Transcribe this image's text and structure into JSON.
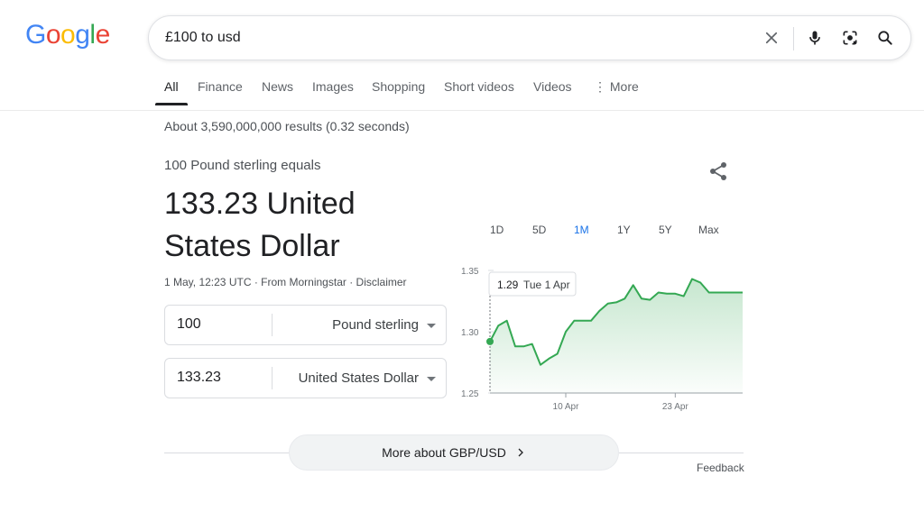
{
  "logo": {
    "letters": [
      "G",
      "o",
      "o",
      "g",
      "l",
      "e"
    ],
    "colors": [
      "#4285f4",
      "#ea4335",
      "#fbbc05",
      "#4285f4",
      "#34a853",
      "#ea4335"
    ]
  },
  "search": {
    "query": "£100 to usd",
    "icons": [
      "clear-icon",
      "mic-icon",
      "lens-icon",
      "search-icon"
    ]
  },
  "tabs": [
    {
      "label": "All",
      "active": true
    },
    {
      "label": "Finance"
    },
    {
      "label": "News"
    },
    {
      "label": "Images"
    },
    {
      "label": "Shopping"
    },
    {
      "label": "Short videos"
    },
    {
      "label": "Videos"
    },
    {
      "label": "More",
      "icon": "more-vert-icon"
    }
  ],
  "stats": "About 3,590,000,000 results (0.32 seconds)",
  "converter": {
    "equals_label": "100 Pound sterling equals",
    "result": "133.23 United States Dollar",
    "timestamp": "1 May, 12:23 UTC",
    "source": "From Morningstar",
    "disclaimer": "Disclaimer",
    "dot": "·",
    "from": {
      "value": "100",
      "unit": "Pound sterling"
    },
    "to": {
      "value": "133.23",
      "unit": "United States Dollar"
    }
  },
  "ranges": [
    {
      "label": "1D"
    },
    {
      "label": "5D"
    },
    {
      "label": "1M",
      "active": true
    },
    {
      "label": "1Y"
    },
    {
      "label": "5Y"
    },
    {
      "label": "Max"
    }
  ],
  "tooltip": {
    "value": "1.29",
    "date": "Tue 1 Apr"
  },
  "accent_color": "#34a853",
  "active_tab_color": "#1a73e8",
  "more_button": "More about GBP/USD",
  "feedback": "Feedback",
  "chart_data": {
    "type": "area",
    "title": "",
    "xlabel": "",
    "ylabel": "",
    "ylim": [
      1.25,
      1.35
    ],
    "yticks": [
      "1.35",
      "1.30",
      "1.25"
    ],
    "ytick_values": [
      1.35,
      1.3,
      1.25
    ],
    "xticks": [
      "10 Apr",
      "23 Apr"
    ],
    "xtick_dates": [
      "2025-04-10",
      "2025-04-23"
    ],
    "x": [
      "2025-04-01",
      "2025-04-02",
      "2025-04-03",
      "2025-04-04",
      "2025-04-05",
      "2025-04-06",
      "2025-04-07",
      "2025-04-08",
      "2025-04-09",
      "2025-04-10",
      "2025-04-11",
      "2025-04-12",
      "2025-04-13",
      "2025-04-14",
      "2025-04-15",
      "2025-04-16",
      "2025-04-17",
      "2025-04-18",
      "2025-04-19",
      "2025-04-20",
      "2025-04-21",
      "2025-04-22",
      "2025-04-23",
      "2025-04-24",
      "2025-04-25",
      "2025-04-26",
      "2025-04-27",
      "2025-04-28",
      "2025-04-29",
      "2025-04-30",
      "2025-05-01"
    ],
    "values": [
      1.292,
      1.305,
      1.309,
      1.288,
      1.288,
      1.29,
      1.273,
      1.278,
      1.282,
      1.3,
      1.309,
      1.309,
      1.309,
      1.317,
      1.323,
      1.324,
      1.327,
      1.338,
      1.327,
      1.326,
      1.332,
      1.331,
      1.331,
      1.329,
      1.343,
      1.34,
      1.332,
      1.332,
      1.332,
      1.332,
      1.332
    ],
    "grid": false
  }
}
